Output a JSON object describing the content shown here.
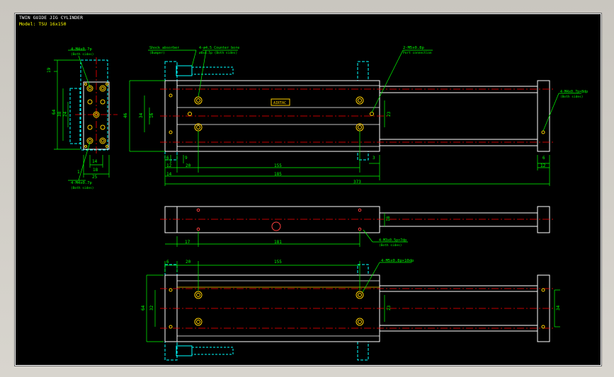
{
  "window": {
    "background": "#000000"
  },
  "colors": {
    "outline": "#ffffff",
    "dimension": "#00ff00",
    "centerline": "#ff0000",
    "hidden": "#00ffff",
    "holes": "#ffd000",
    "title": "#ffffff",
    "model": "#ffff00"
  },
  "title": {
    "line1": "TWIN GUIDE JIG CYLINDER",
    "line2": "Model: TSU 16x150"
  },
  "notes": {
    "top_left_thread": "4-M4x0.7p",
    "top_left_thread_sub": "(Both sides)",
    "bottom_left_thread": "4-M4x0.7p",
    "bottom_left_thread_sub": "(Both sides)",
    "shock_absorber": "Shock absorber",
    "shock_absorber_sub": "(Bumper)",
    "counter_bore": "4-ø4.5 Counter bore",
    "counter_bore_sub": "ø8x4.5p (Both sides)",
    "port": "2-M5x0.8p",
    "port_sub": "Port connection",
    "rod_end_thread": "4-M4x0.7p×8dp",
    "rod_end_thread_sub": "(Both sides)",
    "middle_thread": "4-M3x0.5p×7dp",
    "middle_thread_sub": "(Both sides)",
    "bottom_thread": "4-M5x0.8p×10dp",
    "nameplate": "AIRTAC"
  },
  "dimensions": {
    "side_19": "19",
    "side_64": "64",
    "side_38": "38",
    "side_24": "24",
    "side_14": "14",
    "side_18": "18",
    "side_25": "25",
    "side_1": "1",
    "front_46": "46",
    "front_34": "34",
    "front_16": "16",
    "front_23": "23",
    "front_6": "6",
    "front_9": "9",
    "front_12": "12",
    "front_20": "20",
    "front_155": "155",
    "front_3": "3",
    "front_14": "14",
    "front_185": "185",
    "front_373": "373",
    "front_end_6": "6",
    "front_end_12": "12",
    "mid_18": "18",
    "mid_17": "17",
    "mid_181": "181",
    "bot_6": "6",
    "bot_20": "20",
    "bot_155": "155",
    "bot_64": "64",
    "bot_32": "32",
    "bot_23": "23",
    "bot_34": "34"
  }
}
